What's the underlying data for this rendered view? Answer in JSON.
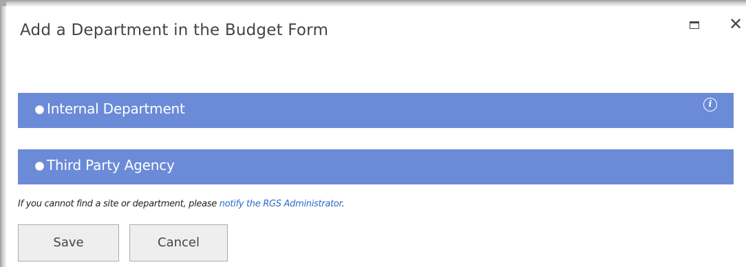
{
  "dialog": {
    "title": "Add a Department in the Budget Form",
    "controls": {
      "maximize_icon": "maximize-icon",
      "close_symbol": "✕"
    }
  },
  "options": [
    {
      "label": "Internal Department",
      "selected": false,
      "info_symbol": "i"
    },
    {
      "label": "Third Party Agency",
      "selected": false
    }
  ],
  "notice": {
    "text": "If you cannot find a site or department, please ",
    "link_text": "notify the RGS Administrator",
    "suffix": "."
  },
  "buttons": {
    "save_label": "Save",
    "cancel_label": "Cancel"
  },
  "colors": {
    "option_bar": "#6b8bd8",
    "link": "#2a6cc6",
    "button_bg": "#eeeeee",
    "title_text": "#444444"
  }
}
